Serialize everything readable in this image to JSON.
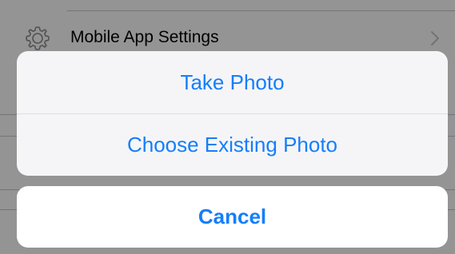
{
  "background": {
    "settings_row": {
      "icon": "gear-icon",
      "label": "Mobile App Settings",
      "chevron_icon": "chevron-right-icon"
    }
  },
  "action_sheet": {
    "actions": [
      {
        "label": "Take Photo"
      },
      {
        "label": "Choose Existing Photo"
      }
    ],
    "cancel_label": "Cancel"
  },
  "colors": {
    "accent": "#147efb",
    "overlay": "rgba(0,0,0,0.42)",
    "sheet_background": "#f8f8fa",
    "separator": "#c8c7cc"
  }
}
